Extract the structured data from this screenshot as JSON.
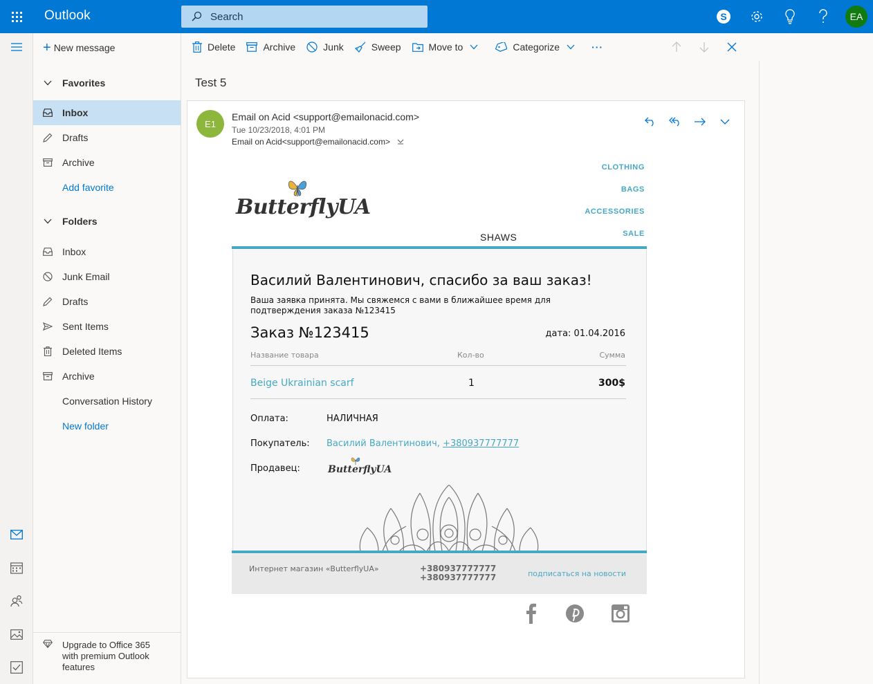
{
  "app": {
    "title": "Outlook",
    "avatar_initials": "EA"
  },
  "search": {
    "placeholder": "Search"
  },
  "folder_pane": {
    "new_message": "New message",
    "favorites_header": "Favorites",
    "favorites": [
      {
        "label": "Inbox",
        "icon": "inbox-icon",
        "selected": true
      },
      {
        "label": "Drafts",
        "icon": "pencil-icon"
      },
      {
        "label": "Archive",
        "icon": "archive-icon"
      },
      {
        "label": "Add favorite",
        "icon": ""
      }
    ],
    "folders_header": "Folders",
    "folders": [
      {
        "label": "Inbox",
        "icon": "inbox-icon"
      },
      {
        "label": "Junk Email",
        "icon": "block-icon"
      },
      {
        "label": "Drafts",
        "icon": "pencil-icon"
      },
      {
        "label": "Sent Items",
        "icon": "send-icon"
      },
      {
        "label": "Deleted Items",
        "icon": "trash-icon"
      },
      {
        "label": "Archive",
        "icon": "archive-icon"
      },
      {
        "label": "Conversation History",
        "icon": ""
      },
      {
        "label": "New folder",
        "icon": ""
      }
    ],
    "upgrade": "Upgrade to Office 365 with premium Outlook features"
  },
  "toolbar": {
    "delete": "Delete",
    "archive": "Archive",
    "junk": "Junk",
    "sweep": "Sweep",
    "move_to": "Move to",
    "categorize": "Categorize",
    "more": "···"
  },
  "message": {
    "subject": "Test 5",
    "avatar": "E1",
    "from": "Email on Acid <support@emailonacid.com>",
    "date": "Tue 10/23/2018, 4:01 PM",
    "to": "Email on Acid<support@emailonacid.com>"
  },
  "email": {
    "nav": [
      "CLOTHING",
      "BAGS",
      "ACCESSORIES",
      "SALE"
    ],
    "logo_text": "ButterflyUA",
    "category": "SHAWS",
    "title": "Василий Валентинович, спасибо за ваш заказ!",
    "subtitle": "Ваша заявка принята. Мы свяжемся с вами в ближайшее время для подтверждения заказа №123415",
    "order_no": "Заказ №123415",
    "order_date": "дата: 01.04.2016",
    "col_product": "Название товара",
    "col_qty": "Кол-во",
    "col_sum": "Сумма",
    "product": "Beige Ukrainian scarf",
    "qty": "1",
    "sum": "300$",
    "payment_label": "Оплата:",
    "payment_value": "НАЛИЧНАЯ",
    "buyer_label": "Покупатель:",
    "buyer_name": "Василий Валентинович,",
    "buyer_phone": "+380937777777",
    "seller_label": "Продавец:",
    "seller_logo_text": "ButterflyUA",
    "footer_shop": "Интернет магазин «ButterflyUA»",
    "footer_phone1": "+380937777777",
    "footer_phone2": "+380937777777",
    "footer_subscribe": "подписаться на новости"
  },
  "colors": {
    "brand": "#0078d4",
    "selected_folder": "#c7e0f4",
    "email_accent": "#46a9c4",
    "avatar_sender": "#8cb63c",
    "avatar_user": "#107c10"
  }
}
